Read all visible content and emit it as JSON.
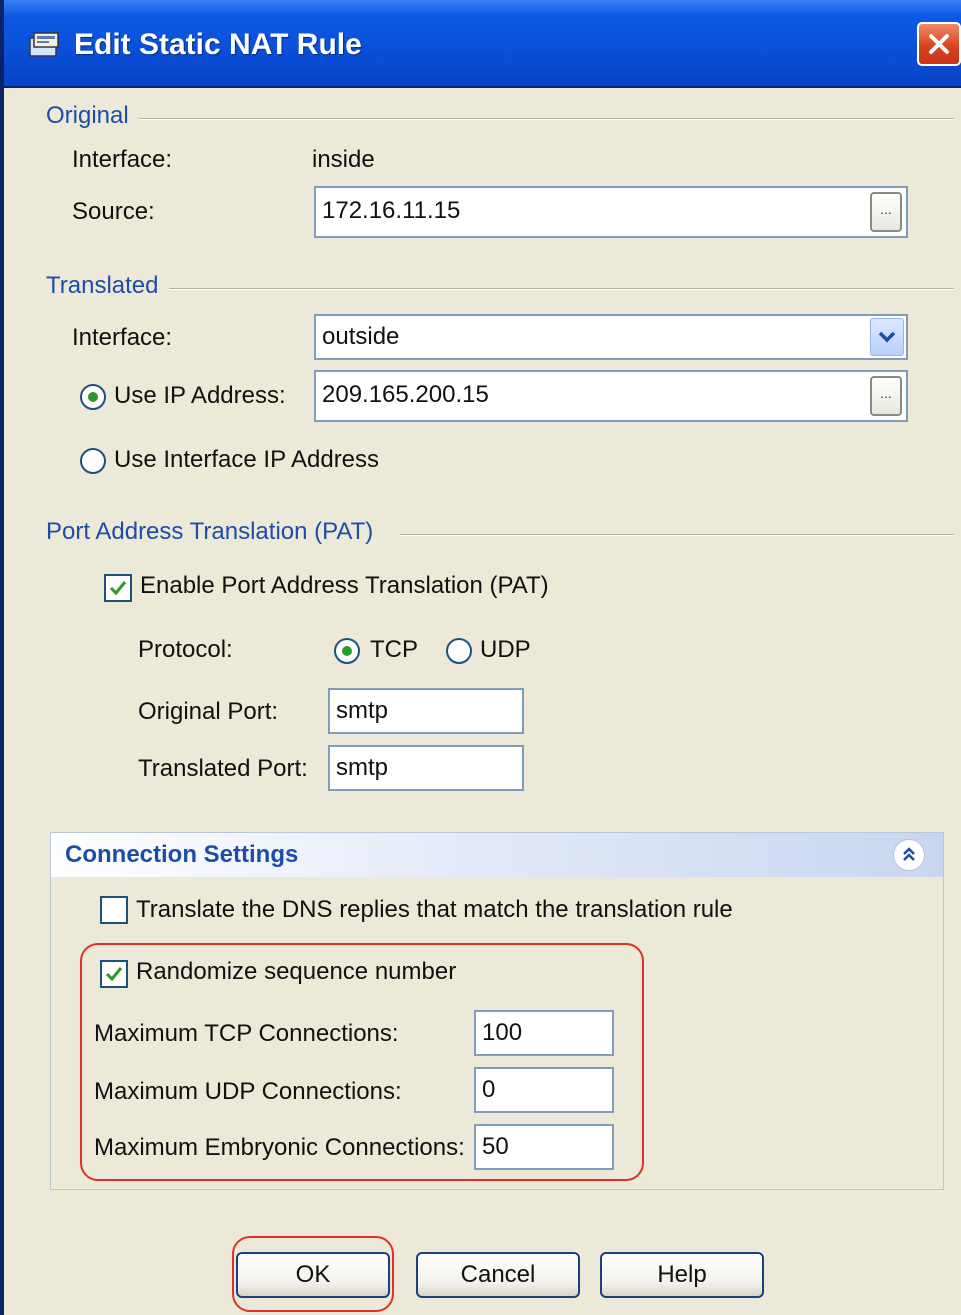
{
  "window": {
    "title": "Edit Static NAT Rule"
  },
  "original": {
    "section": "Original",
    "interface_label": "Interface:",
    "interface_value": "inside",
    "source_label": "Source:",
    "source_value": "172.16.11.15",
    "browse_label": "..."
  },
  "translated": {
    "section": "Translated",
    "interface_label": "Interface:",
    "interface_value": "outside",
    "use_ip_label": "Use IP Address:",
    "use_ip_value": "209.165.200.15",
    "use_ip_selected": true,
    "use_interface_label": "Use Interface IP Address",
    "use_interface_selected": false,
    "browse_label": "..."
  },
  "pat": {
    "section": "Port Address Translation (PAT)",
    "enable_label": "Enable Port Address Translation (PAT)",
    "enable_checked": true,
    "protocol_label": "Protocol:",
    "tcp_label": "TCP",
    "udp_label": "UDP",
    "protocol_selected": "TCP",
    "original_port_label": "Original Port:",
    "original_port_value": "smtp",
    "translated_port_label": "Translated Port:",
    "translated_port_value": "smtp"
  },
  "connection": {
    "title": "Connection Settings",
    "dns_label": "Translate the DNS replies that match the translation rule",
    "dns_checked": false,
    "randomize_label": "Randomize sequence number",
    "randomize_checked": true,
    "max_tcp_label": "Maximum TCP Connections:",
    "max_tcp_value": "100",
    "max_udp_label": "Maximum UDP Connections:",
    "max_udp_value": "0",
    "max_embryonic_label": "Maximum Embryonic Connections:",
    "max_embryonic_value": "50"
  },
  "buttons": {
    "ok": "OK",
    "cancel": "Cancel",
    "help": "Help"
  },
  "colors": {
    "titlebar": "#0a4fd8",
    "section_title": "#1c4ea8",
    "highlight": "#e0302a",
    "dialog_bg": "#ece9d8"
  }
}
